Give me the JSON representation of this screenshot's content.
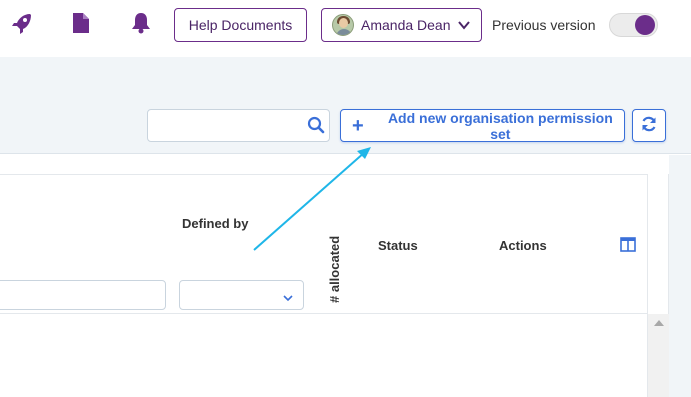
{
  "topbar": {
    "icons": [
      "rocket-icon",
      "document-icon",
      "bell-icon"
    ],
    "help_label": "Help Documents",
    "user_name": "Amanda Dean",
    "previous_version_label": "Previous version",
    "previous_version_on": true
  },
  "toolbar": {
    "search_value": "",
    "search_placeholder": "",
    "add_label": "Add new organisation permission set",
    "refresh_icon": "refresh-icon"
  },
  "table": {
    "columns": {
      "defined_by": "Defined by",
      "allocated": "# allocated",
      "status": "Status",
      "actions": "Actions"
    },
    "filters": {
      "name_value": "",
      "defined_by_selected": ""
    }
  },
  "colors": {
    "brand_purple": "#6b2d8a",
    "accent_blue": "#3a6fd8",
    "annotation_cyan": "#1fb6e8",
    "toolbar_bg": "#f1f5f8"
  }
}
